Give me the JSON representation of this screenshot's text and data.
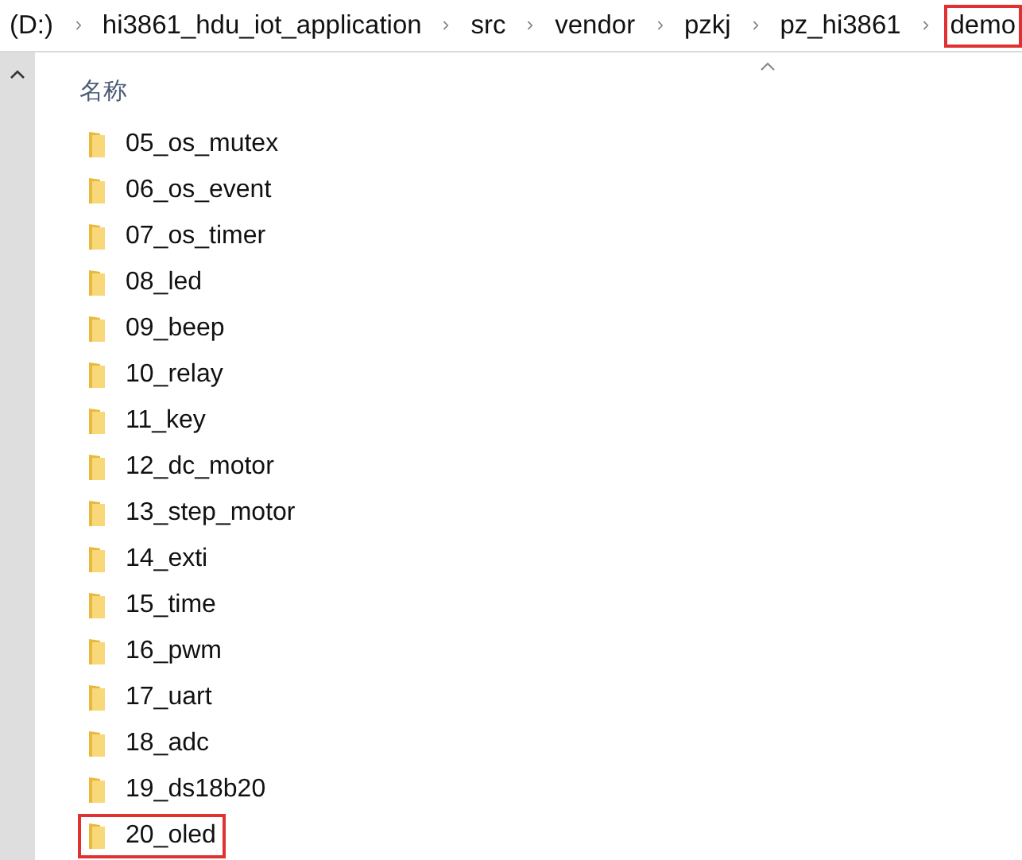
{
  "breadcrumb": [
    {
      "label": "(D:)",
      "highlighted": false
    },
    {
      "label": "hi3861_hdu_iot_application",
      "highlighted": false
    },
    {
      "label": "src",
      "highlighted": false
    },
    {
      "label": "vendor",
      "highlighted": false
    },
    {
      "label": "pzkj",
      "highlighted": false
    },
    {
      "label": "pz_hi3861",
      "highlighted": false
    },
    {
      "label": "demo",
      "highlighted": true
    }
  ],
  "column": {
    "label": "名称"
  },
  "files": [
    {
      "name": "05_os_mutex",
      "highlighted": false
    },
    {
      "name": "06_os_event",
      "highlighted": false
    },
    {
      "name": "07_os_timer",
      "highlighted": false
    },
    {
      "name": "08_led",
      "highlighted": false
    },
    {
      "name": "09_beep",
      "highlighted": false
    },
    {
      "name": "10_relay",
      "highlighted": false
    },
    {
      "name": "11_key",
      "highlighted": false
    },
    {
      "name": "12_dc_motor",
      "highlighted": false
    },
    {
      "name": "13_step_motor",
      "highlighted": false
    },
    {
      "name": "14_exti",
      "highlighted": false
    },
    {
      "name": "15_time",
      "highlighted": false
    },
    {
      "name": "16_pwm",
      "highlighted": false
    },
    {
      "name": "17_uart",
      "highlighted": false
    },
    {
      "name": "18_adc",
      "highlighted": false
    },
    {
      "name": "19_ds18b20",
      "highlighted": false
    },
    {
      "name": "20_oled",
      "highlighted": true
    }
  ]
}
